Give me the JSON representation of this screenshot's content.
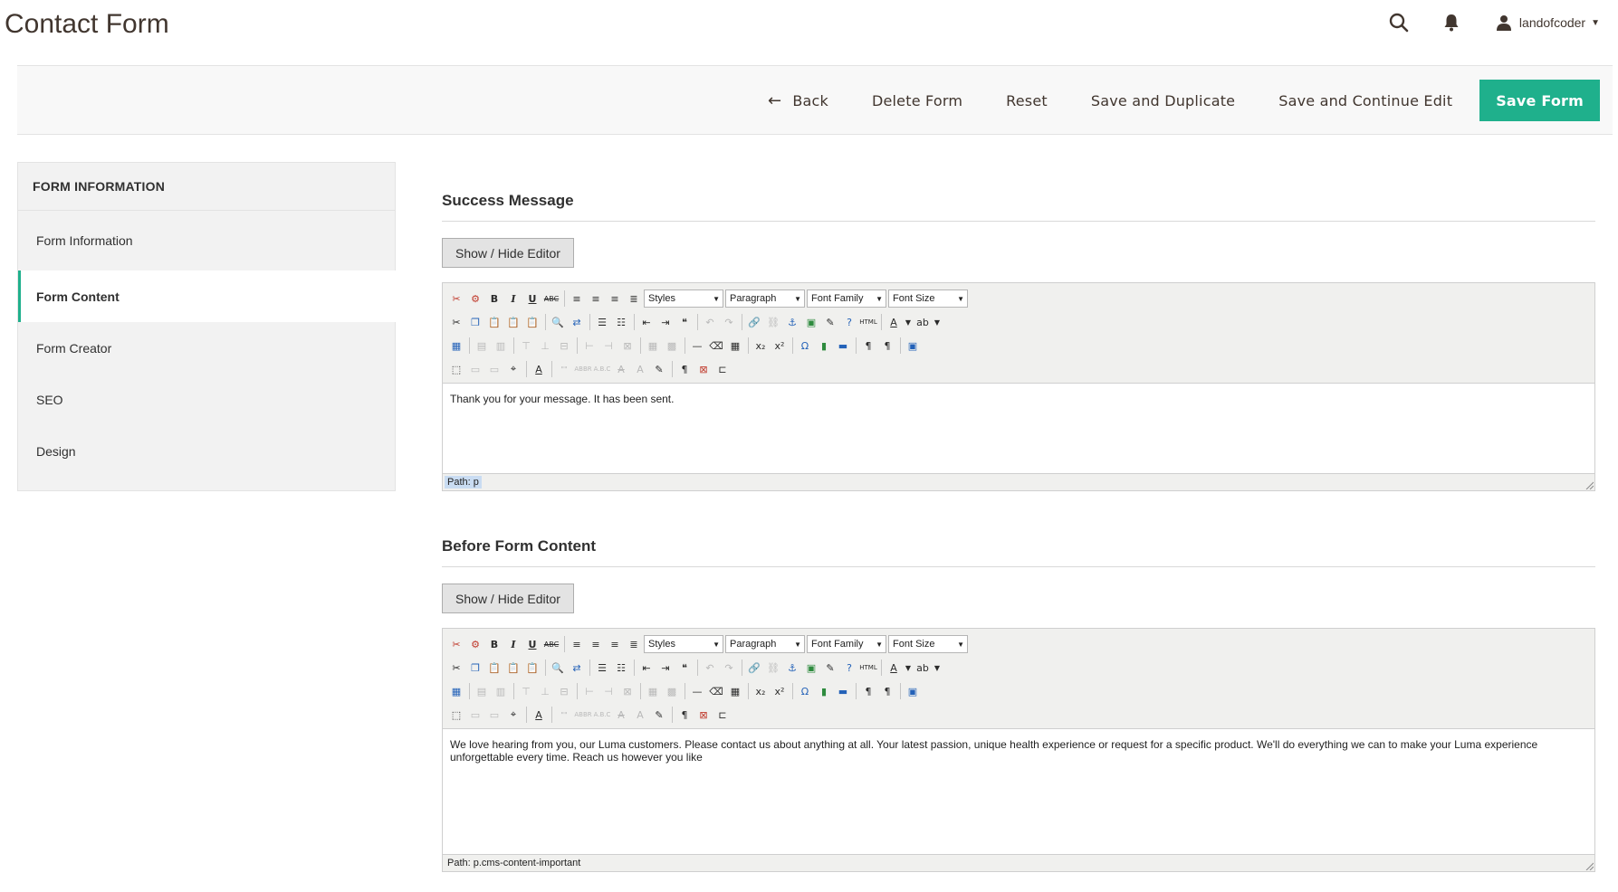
{
  "header": {
    "title": "Contact Form",
    "search_icon": "search-icon",
    "bell_icon": "bell-icon",
    "user_name": "landofcoder"
  },
  "actions": {
    "back": "Back",
    "delete": "Delete Form",
    "reset": "Reset",
    "save_duplicate": "Save and Duplicate",
    "save_continue": "Save and Continue Edit",
    "save": "Save Form"
  },
  "colors": {
    "accent": "#1fb08c",
    "title": "#41362f"
  },
  "sidebar": {
    "heading": "FORM INFORMATION",
    "items": [
      {
        "label": "Form Information",
        "active": false
      },
      {
        "label": "Form Content",
        "active": true
      },
      {
        "label": "Form Creator",
        "active": false
      },
      {
        "label": "SEO",
        "active": false
      },
      {
        "label": "Design",
        "active": false
      }
    ]
  },
  "editor_common": {
    "toggle_label": "Show / Hide Editor",
    "styles": "Styles",
    "format": "Paragraph",
    "font_family": "Font Family",
    "font_size": "Font Size"
  },
  "success": {
    "title": "Success Message",
    "content": "Thank you for your message. It has been sent.",
    "path": "Path: p"
  },
  "before": {
    "title": "Before Form Content",
    "content": "We love hearing from you, our Luma customers. Please contact us about anything at all. Your latest passion, unique health experience or request for a specific product. We'll do everything we can to make your Luma experience unforgettable every time. Reach us however you like",
    "path": "Path: p.cms-content-important"
  }
}
